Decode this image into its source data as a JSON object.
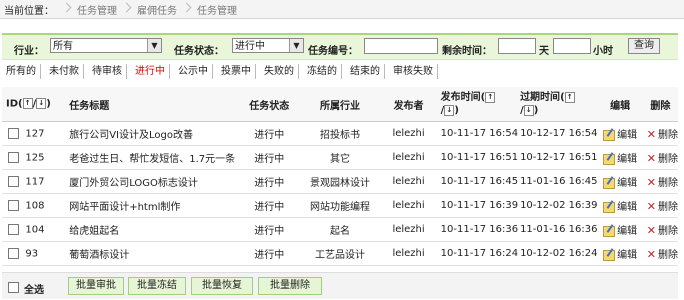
{
  "breadcrumb": {
    "label": "当前位置：",
    "items": [
      "任务管理",
      "雇佣任务",
      "任务管理"
    ]
  },
  "filter": {
    "industry_label": "行业：",
    "industry_value": "所有",
    "status_label": "任务状态：",
    "status_value": "进行中",
    "number_label": "任务编号：",
    "number_value": "",
    "remaining_label": "剩余时间：",
    "unit_day": "天",
    "unit_hour": "小时",
    "query_label": "查询"
  },
  "tabs": [
    "所有的",
    "未付款",
    "待审核",
    "进行中",
    "公示中",
    "投票中",
    "失败的",
    "冻结的",
    "结束的",
    "审核失败"
  ],
  "active_tab": "进行中",
  "table": {
    "headers": {
      "id": "ID",
      "title": "任务标题",
      "status": "任务状态",
      "industry": "所属行业",
      "publisher": "发布者",
      "pub_time": "发布时间",
      "end_time": "过期时间",
      "edit": "编辑",
      "delete": "删除"
    },
    "sort_up": "↑",
    "sort_down": "↓",
    "edit_label": "编辑",
    "delete_label": "删除",
    "rows": [
      {
        "id": "127",
        "title": "旅行公司VI设计及Logo改善",
        "status": "进行中",
        "industry": "招投标书",
        "publisher": "lelezhi",
        "pub_time": "10-11-17 16:54",
        "end_time": "10-12-17 16:54"
      },
      {
        "id": "125",
        "title": "老爸过生日、帮忙发短信、1.7元一条",
        "status": "进行中",
        "industry": "其它",
        "publisher": "lelezhi",
        "pub_time": "10-11-17 16:51",
        "end_time": "10-12-17 16:51"
      },
      {
        "id": "117",
        "title": "厦门外贸公司LOGO标志设计",
        "status": "进行中",
        "industry": "景观园林设计",
        "publisher": "lelezhi",
        "pub_time": "10-11-17 16:45",
        "end_time": "11-01-16 16:45"
      },
      {
        "id": "108",
        "title": "网站平面设计+html制作",
        "status": "进行中",
        "industry": "网站功能编程",
        "publisher": "lelezhi",
        "pub_time": "10-11-17 16:39",
        "end_time": "10-12-02 16:39"
      },
      {
        "id": "104",
        "title": "给虎姐起名",
        "status": "进行中",
        "industry": "起名",
        "publisher": "lelezhi",
        "pub_time": "10-11-17 16:36",
        "end_time": "11-01-16 16:36"
      },
      {
        "id": "93",
        "title": "葡萄酒标设计",
        "status": "进行中",
        "industry": "工艺品设计",
        "publisher": "lelezhi",
        "pub_time": "10-11-17 16:24",
        "end_time": "10-12-02 16:24"
      }
    ]
  },
  "footer": {
    "select_all": "全选",
    "batch_approve": "批量审批",
    "batch_freeze": "批量冻结",
    "batch_restore": "批量恢复",
    "batch_delete": "批量删除"
  }
}
